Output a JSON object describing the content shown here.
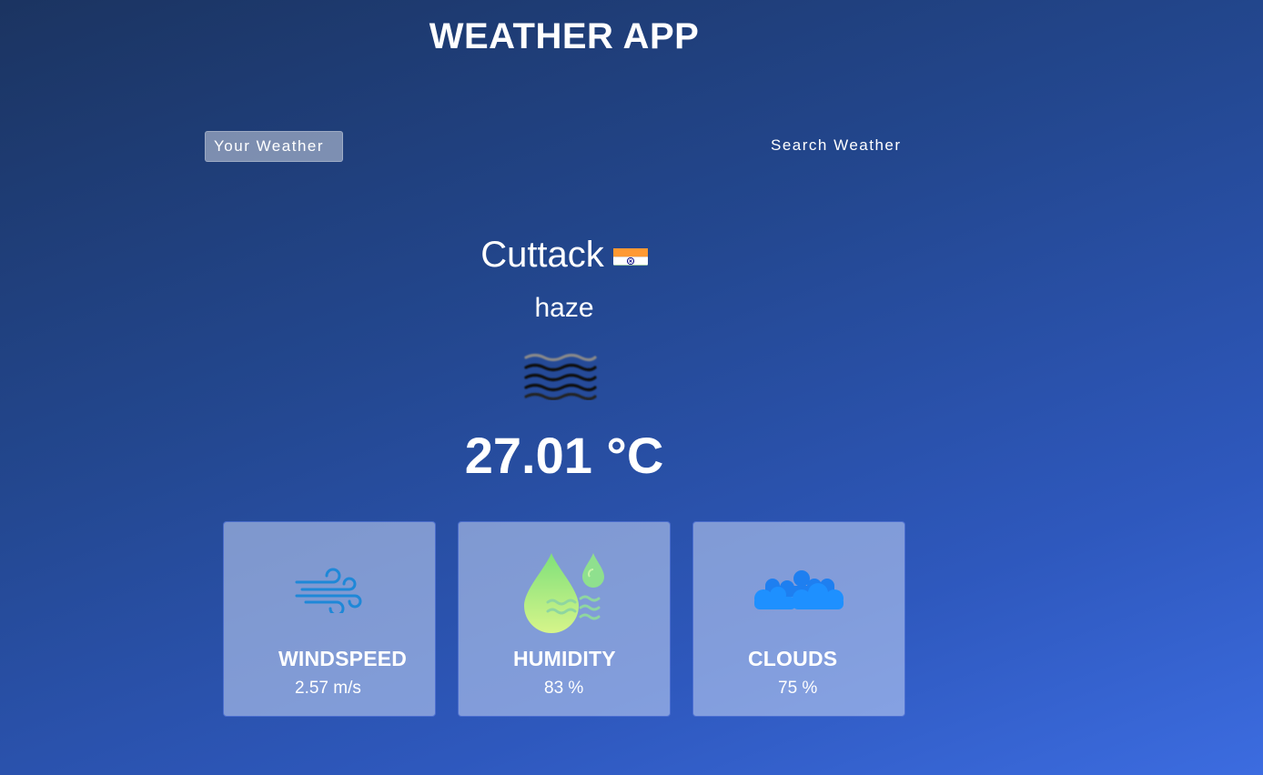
{
  "app": {
    "title": "WEATHER APP"
  },
  "tabs": [
    {
      "label": "Your Weather",
      "active": true
    },
    {
      "label": "Search Weather",
      "active": false
    }
  ],
  "weather": {
    "city": "Cuttack",
    "country_flag": "india-flag-icon",
    "description": "haze",
    "icon": "haze-icon",
    "temperature": "27.01 °C"
  },
  "stats": [
    {
      "icon": "wind-icon",
      "label": "WINDSPEED",
      "value": "2.57 m/s"
    },
    {
      "icon": "humidity-icon",
      "label": "HUMIDITY",
      "value": "83 %"
    },
    {
      "icon": "clouds-icon",
      "label": "CLOUDS",
      "value": "75 %"
    }
  ],
  "colors": {
    "background_top": "#1b3461",
    "background_bottom": "#3c6ce0",
    "wind_icon": "#1e88d8",
    "humidity_icon": "#b4ef7a",
    "cloud_icon": "#1e90ff"
  }
}
